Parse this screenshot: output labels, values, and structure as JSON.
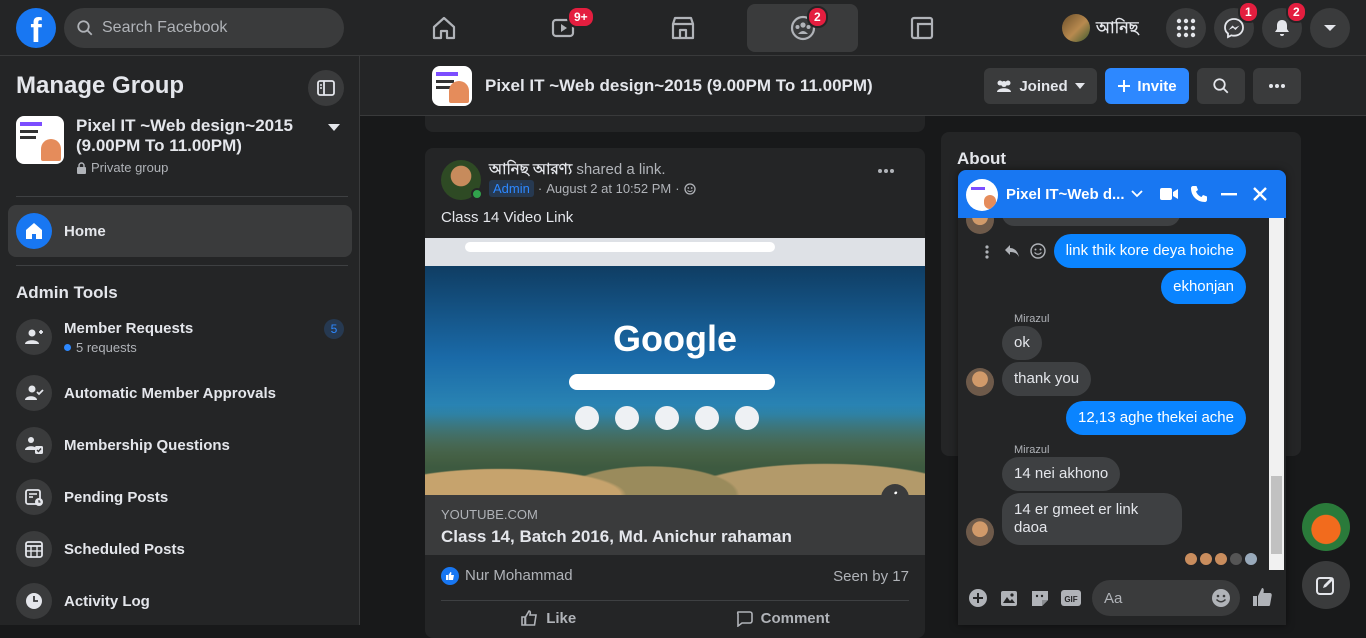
{
  "topbar": {
    "logo": "f",
    "search_placeholder": "Search Facebook",
    "watch_badge": "9+",
    "groups_badge": "2",
    "profile_name": "আনিছ",
    "messenger_badge": "1",
    "notifications_badge": "2"
  },
  "sidebar": {
    "title": "Manage Group",
    "group_name": "Pixel IT ~Web design~2015 (9.00PM To 11.00PM)",
    "group_privacy": "Private group",
    "home_label": "Home",
    "admin_tools_title": "Admin Tools",
    "items": [
      {
        "label": "Member Requests",
        "sub": "5 requests",
        "count": "5",
        "icon": "add-person-icon"
      },
      {
        "label": "Automatic Member Approvals",
        "icon": "person-check-icon"
      },
      {
        "label": "Membership Questions",
        "icon": "questions-icon"
      },
      {
        "label": "Pending Posts",
        "icon": "pending-posts-icon"
      },
      {
        "label": "Scheduled Posts",
        "icon": "calendar-icon"
      },
      {
        "label": "Activity Log",
        "icon": "clock-icon"
      }
    ]
  },
  "group_header": {
    "title": "Pixel IT ~Web design~2015 (9.00PM To 11.00PM)",
    "joined_label": "Joined",
    "invite_label": "Invite"
  },
  "post": {
    "author": "আনিছ আরণ্য",
    "action": "shared a link.",
    "role": "Admin",
    "time": "August 2 at 10:52 PM",
    "text": "Class 14 Video Link",
    "media_word": "Google",
    "link_source": "YOUTUBE.COM",
    "link_title": "Class 14, Batch 2016, Md. Anichur rahaman",
    "reaction_name": "Nur Mohammad",
    "seen": "Seen by 17",
    "like_label": "Like",
    "comment_label": "Comment"
  },
  "about": {
    "title": "About"
  },
  "chat": {
    "title": "Pixel IT~Web d...",
    "input_placeholder": "Aa",
    "messages": [
      {
        "side": "right",
        "text": "link thik kore deya hoiche"
      },
      {
        "side": "right",
        "text": "ekhonjan"
      },
      {
        "side": "left",
        "sender": "Mirazul",
        "text": "ok"
      },
      {
        "side": "left",
        "text": "thank you"
      },
      {
        "side": "right",
        "text": "12,13 aghe thekei ache"
      },
      {
        "side": "left",
        "sender": "Mirazul",
        "text": "14 nei akhono"
      },
      {
        "side": "left",
        "text": "14 er gmeet er link daoa"
      }
    ]
  },
  "colors": {
    "accent": "#1877f2",
    "background": "#18191a",
    "surface": "#242526",
    "badge": "#e41e3f"
  }
}
